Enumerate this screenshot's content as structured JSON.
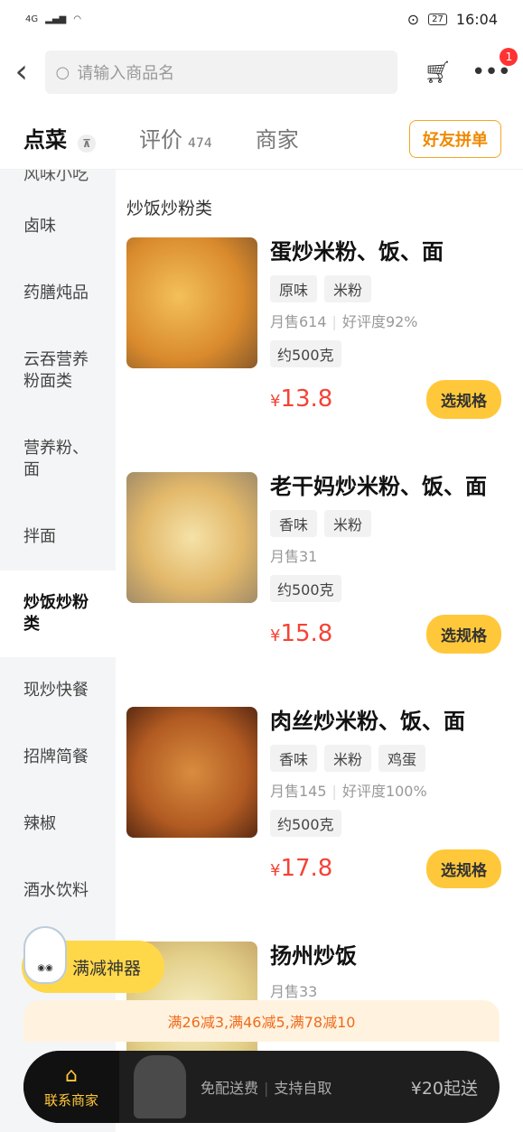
{
  "status_bar": {
    "time": "16:04",
    "battery": "27",
    "network": "4G"
  },
  "header": {
    "search_placeholder": "请输入商品名",
    "notification_count": "1"
  },
  "tabs": [
    {
      "label": "点菜",
      "count": ""
    },
    {
      "label": "评价",
      "count": "474"
    },
    {
      "label": "商家",
      "count": ""
    }
  ],
  "group_order_label": "好友拼单",
  "sidebar": {
    "categories": [
      "风味小吃",
      "卤味",
      "药膳炖品",
      "云吞营养粉面类",
      "营养粉、面",
      "拌面",
      "炒饭炒粉类",
      "现炒快餐",
      "招牌简餐",
      "辣椒",
      "酒水饮料"
    ],
    "active": "炒饭炒粉类"
  },
  "section_title": "炒饭炒粉类",
  "items": [
    {
      "name": "蛋炒米粉、饭、面",
      "tags": [
        "原味",
        "米粉"
      ],
      "sales": "月售614",
      "rating": "好评度92%",
      "weight": "约500克",
      "currency": "¥",
      "price": "13.8",
      "button": "选规格"
    },
    {
      "name": "老干妈炒米粉、饭、面",
      "tags": [
        "香味",
        "米粉"
      ],
      "sales": "月售31",
      "rating": "",
      "weight": "约500克",
      "currency": "¥",
      "price": "15.8",
      "button": "选规格"
    },
    {
      "name": "肉丝炒米粉、饭、面",
      "tags": [
        "香味",
        "米粉",
        "鸡蛋"
      ],
      "sales": "月售145",
      "rating": "好评度100%",
      "weight": "约500克",
      "currency": "¥",
      "price": "17.8",
      "button": "选规格"
    },
    {
      "name": "扬州炒饭",
      "tags": [],
      "sales": "月售33",
      "rating": "",
      "weight": "",
      "currency": "",
      "price": "",
      "button": ""
    }
  ],
  "promo_label": "满减神器",
  "discount_text": "满26减3,满46减5,满78减10",
  "bottom_bar": {
    "contact_label": "联系商家",
    "free_delivery": "免配送费",
    "pickup": "支持自取",
    "min_order": "¥20起送"
  },
  "colors": {
    "accent": "#ffc83a",
    "price": "#f44336",
    "discount": "#f06a1a"
  }
}
